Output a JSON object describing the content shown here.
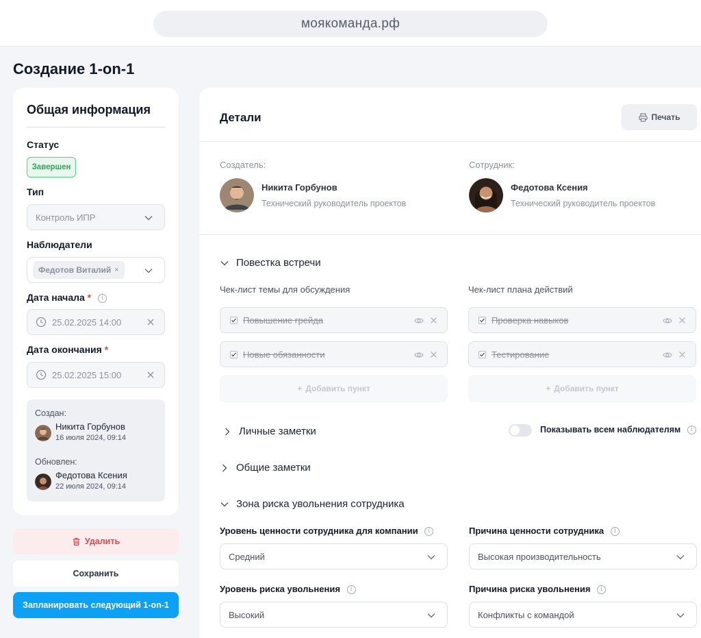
{
  "browser": {
    "url": "моякоманда.рф"
  },
  "page_title": "Создание 1-on-1",
  "general": {
    "title": "Общая информация",
    "status_label": "Статус",
    "status_value": "Завершен",
    "type_label": "Тип",
    "type_value": "Контроль ИПР",
    "observers_label": "Наблюдатели",
    "observer_chip": "Федотов Виталий",
    "observer_chip_remove": "×",
    "start_label": "Дата начала",
    "start_value": "25.02.2025 14:00",
    "end_label": "Дата окончания",
    "end_value": "25.02.2025 15:00",
    "required_mark": "*",
    "info_glyph": "i",
    "created_label": "Создан:",
    "created_by": "Никита Горбунов",
    "created_date": "16 июля 2024, 09:14",
    "updated_label": "Обновлен:",
    "updated_by": "Федотова Ксения",
    "updated_date": "22 июля 2024, 09:14"
  },
  "actions": {
    "delete": "Удалить",
    "save": "Сохранить",
    "plan_next": "Запланировать следующий 1-on-1"
  },
  "details": {
    "title": "Детали",
    "print": "Печать",
    "creator_label": "Создатель:",
    "creator_name": "Никита Горбунов",
    "creator_role": "Технический руководитель проектов",
    "employee_label": "Сотрудник:",
    "employee_name": "Федотова Ксения",
    "employee_role": "Технический руководитель проектов"
  },
  "agenda": {
    "title": "Повестка встречи",
    "topics_label": "Чек-лист темы для обсуждения",
    "topics": [
      "Повышение грейда",
      "Новые обязанности"
    ],
    "actions_label": "Чек-лист плана действий",
    "action_items": [
      "Проверка навыков",
      "Тестирование"
    ],
    "add_item": "Добавить пункт",
    "add_plus": "+"
  },
  "personal_notes": {
    "title": "Личные заметки",
    "toggle_label": "Показывать всем наблюдателям"
  },
  "shared_notes": {
    "title": "Общие заметки"
  },
  "risk": {
    "title": "Зона риска увольнения сотрудника",
    "value_level_label": "Уровень ценности сотрудника для компании",
    "value_level": "Средний",
    "value_reason_label": "Причина ценности сотрудника",
    "value_reason": "Высокая производительность",
    "risk_level_label": "Уровень риска увольнения",
    "risk_level": "Высокий",
    "risk_reason_label": "Причина риска увольнения",
    "risk_reason": "Конфликты с командой"
  },
  "colors": {
    "primary": "#0da1f5",
    "success": "#2fa454",
    "danger": "#e5434a",
    "background": "#f3f5f8"
  }
}
